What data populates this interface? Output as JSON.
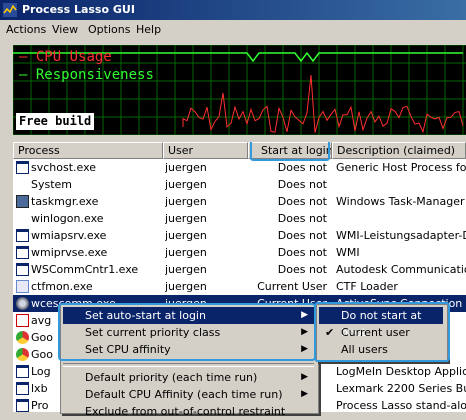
{
  "window": {
    "title": "Process Lasso GUI"
  },
  "menubar": [
    "Actions",
    "View",
    "Options",
    "Help"
  ],
  "graph": {
    "legend_cpu": "CPU Usage",
    "legend_resp": "Responsiveness",
    "free_build": "Free build",
    "colors": {
      "cpu": "#ff3030",
      "responsiveness": "#30ff30",
      "grid": "#006600",
      "background": "#000000"
    }
  },
  "columns": {
    "process": "Process",
    "user": "User",
    "start": "Start at login",
    "desc": "Description (claimed)"
  },
  "rows": [
    {
      "icon": "window-icon",
      "process": "svchost.exe",
      "user": "juergen",
      "start": "Does not",
      "desc": "Generic Host Process for W"
    },
    {
      "icon": "",
      "process": "System",
      "user": "juergen",
      "start": "Does not",
      "desc": ""
    },
    {
      "icon": "taskmgr-icon",
      "process": "taskmgr.exe",
      "user": "juergen",
      "start": "Does not",
      "desc": "Windows Task-Manager"
    },
    {
      "icon": "",
      "process": "winlogon.exe",
      "user": "juergen",
      "start": "Does not",
      "desc": ""
    },
    {
      "icon": "window-icon",
      "process": "wmiapsrv.exe",
      "user": "juergen",
      "start": "Does not",
      "desc": "WMI-Leistungsadapter-Dien"
    },
    {
      "icon": "window-icon",
      "process": "wmiprvse.exe",
      "user": "juergen",
      "start": "Does not",
      "desc": "WMI"
    },
    {
      "icon": "window-icon",
      "process": "WSCommCntr1.exe",
      "user": "juergen",
      "start": "Does not",
      "desc": "Autodesk Communication C"
    },
    {
      "icon": "ctf-icon",
      "process": "ctfmon.exe",
      "user": "juergen",
      "start": "Current User",
      "desc": "CTF Loader"
    },
    {
      "icon": "gear-icon",
      "process": "wcescomm.exe",
      "user": "juergen",
      "start": "Current User",
      "desc": "ActiveSync Connection Man"
    },
    {
      "icon": "avg-icon",
      "process": "avg",
      "user": "",
      "start": "",
      "desc": ""
    },
    {
      "icon": "chrome-icon",
      "process": "Goo",
      "user": "",
      "start": "",
      "desc": ""
    },
    {
      "icon": "chrome-icon",
      "process": "Goo",
      "user": "",
      "start": "",
      "desc": ""
    },
    {
      "icon": "window-icon",
      "process": "Log",
      "user": "",
      "start": "",
      "desc": "LogMeIn Desktop Applicatio"
    },
    {
      "icon": "window-icon",
      "process": "lxb",
      "user": "",
      "start": "",
      "desc": "Lexmark 2200 Series Butto"
    },
    {
      "icon": "window-icon",
      "process": "Pro",
      "user": "",
      "start": "",
      "desc": "Process Lasso stand-alone"
    }
  ],
  "context_menu": {
    "items": [
      {
        "label": "Set auto-start at login",
        "submenu": true,
        "highlight": true
      },
      {
        "label": "Set current priority class",
        "submenu": true,
        "highlight": false
      },
      {
        "label": "Set CPU affinity",
        "submenu": true,
        "highlight": false
      },
      {
        "label": "Default priority (each time run)",
        "submenu": true,
        "highlight": false
      },
      {
        "label": "Default CPU Affinity (each time run)",
        "submenu": true,
        "highlight": false
      },
      {
        "label": "Exclude from out-of-control restraint",
        "submenu": false,
        "highlight": false
      }
    ]
  },
  "submenu": {
    "items": [
      {
        "label": "Do not start at boot",
        "checked": false,
        "highlight": true
      },
      {
        "label": "Current user",
        "checked": true,
        "highlight": false
      },
      {
        "label": "All users",
        "checked": false,
        "highlight": false
      }
    ]
  }
}
